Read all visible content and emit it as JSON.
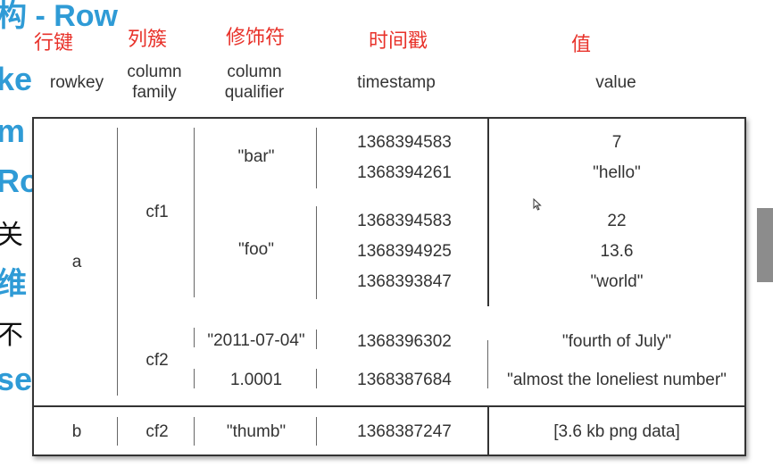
{
  "background": {
    "title_fragment": "构 - Row",
    "side_fragments": [
      "ke",
      "m",
      "Ro",
      "关",
      "维",
      "不",
      "se"
    ]
  },
  "labels_cn": [
    "行键",
    "列簇",
    "修饰符",
    "时间戳",
    "值"
  ],
  "headers": [
    "rowkey",
    "column\nfamily",
    "column\nqualifier",
    "timestamp",
    "value"
  ],
  "rows": {
    "a": {
      "rowkey": "a",
      "cf1": {
        "family": "cf1",
        "bar": {
          "qualifier": "\"bar\"",
          "timestamps": [
            "1368394583",
            "1368394261"
          ],
          "values": [
            "7",
            "\"hello\""
          ]
        },
        "foo": {
          "qualifier": "\"foo\"",
          "timestamps": [
            "1368394583",
            "1368394925",
            "1368393847"
          ],
          "values": [
            "22",
            "13.6",
            "\"world\""
          ]
        }
      },
      "cf2": {
        "family": "cf2",
        "q1": {
          "qualifier": "\"2011-07-04\"",
          "timestamp": "1368396302",
          "value": "\"fourth of July\""
        },
        "q2": {
          "qualifier": "1.0001",
          "timestamp": "1368387684",
          "value": "\"almost the loneliest number\""
        }
      }
    },
    "b": {
      "rowkey": "b",
      "family": "cf2",
      "qualifier": "\"thumb\"",
      "timestamp": "1368387247",
      "value": "[3.6 kb png data]"
    }
  },
  "colors": {
    "accent": "#2f9bd6",
    "label_red": "#e8322a"
  }
}
